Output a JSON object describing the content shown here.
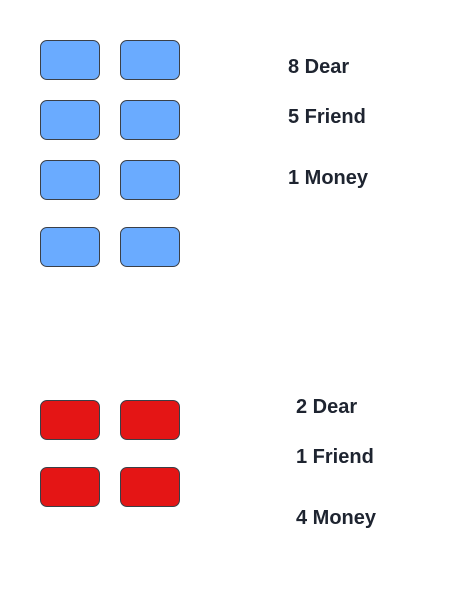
{
  "groups": [
    {
      "color": "#6aabff",
      "tiles": 8,
      "labels": [
        "8 Dear",
        "5 Friend",
        "1 Money"
      ]
    },
    {
      "color": "#e41515",
      "tiles": 4,
      "labels": [
        "2 Dear",
        "1 Friend",
        "4 Money"
      ]
    }
  ]
}
